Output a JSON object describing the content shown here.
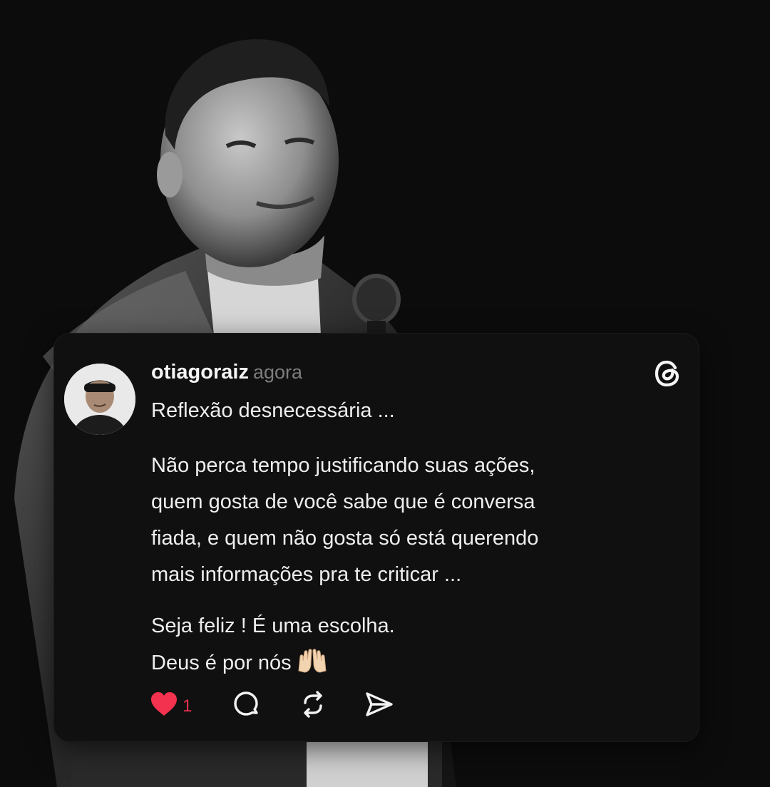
{
  "post": {
    "username": "otiagoraiz",
    "timestamp": "agora",
    "title": "Reflexão desnecessária ...",
    "paragraph1_lines": [
      "Não perca tempo justificando suas ações,",
      "quem gosta de você sabe que é conversa",
      "fiada, e quem não gosta só está querendo",
      "mais informações pra te criticar ..."
    ],
    "paragraph2_lines": [
      "Seja feliz ! É uma escolha.",
      "Deus é por nós"
    ],
    "emoji": "raising-hands-emoji",
    "like_count": "1"
  },
  "icons": {
    "logo": "threads-logo-icon",
    "like": "heart-icon",
    "comment": "comment-icon",
    "repost": "repost-icon",
    "share": "share-send-icon"
  },
  "colors": {
    "background": "#0c0c0c",
    "card": "#101010",
    "text": "#eeeeee",
    "muted": "#7d7d7d",
    "like": "#f2324e"
  }
}
